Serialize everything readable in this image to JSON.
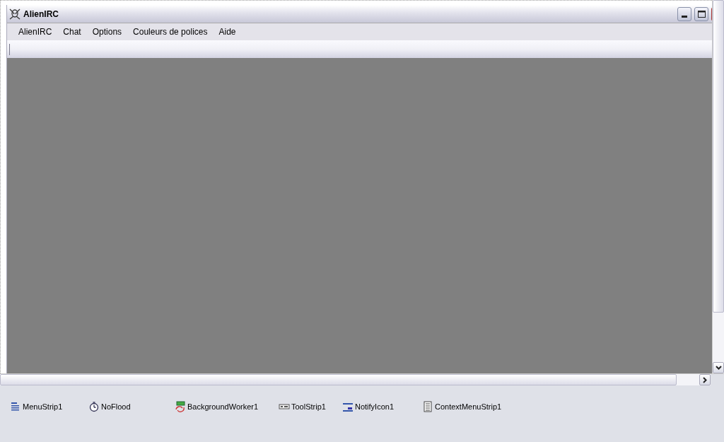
{
  "window": {
    "title": "AlienIRC"
  },
  "menu": [
    "AlienIRC",
    "Chat",
    "Options",
    "Couleurs de polices",
    "Aide"
  ],
  "components": [
    {
      "kind": "menustrip",
      "label": "MenuStrip1"
    },
    {
      "kind": "timer",
      "label": "NoFlood"
    },
    {
      "kind": "worker",
      "label": "BackgroundWorker1"
    },
    {
      "kind": "toolstrip",
      "label": "ToolStrip1"
    },
    {
      "kind": "notify",
      "label": "NotifyIcon1"
    },
    {
      "kind": "contextmenu",
      "label": "ContextMenuStrip1"
    }
  ]
}
